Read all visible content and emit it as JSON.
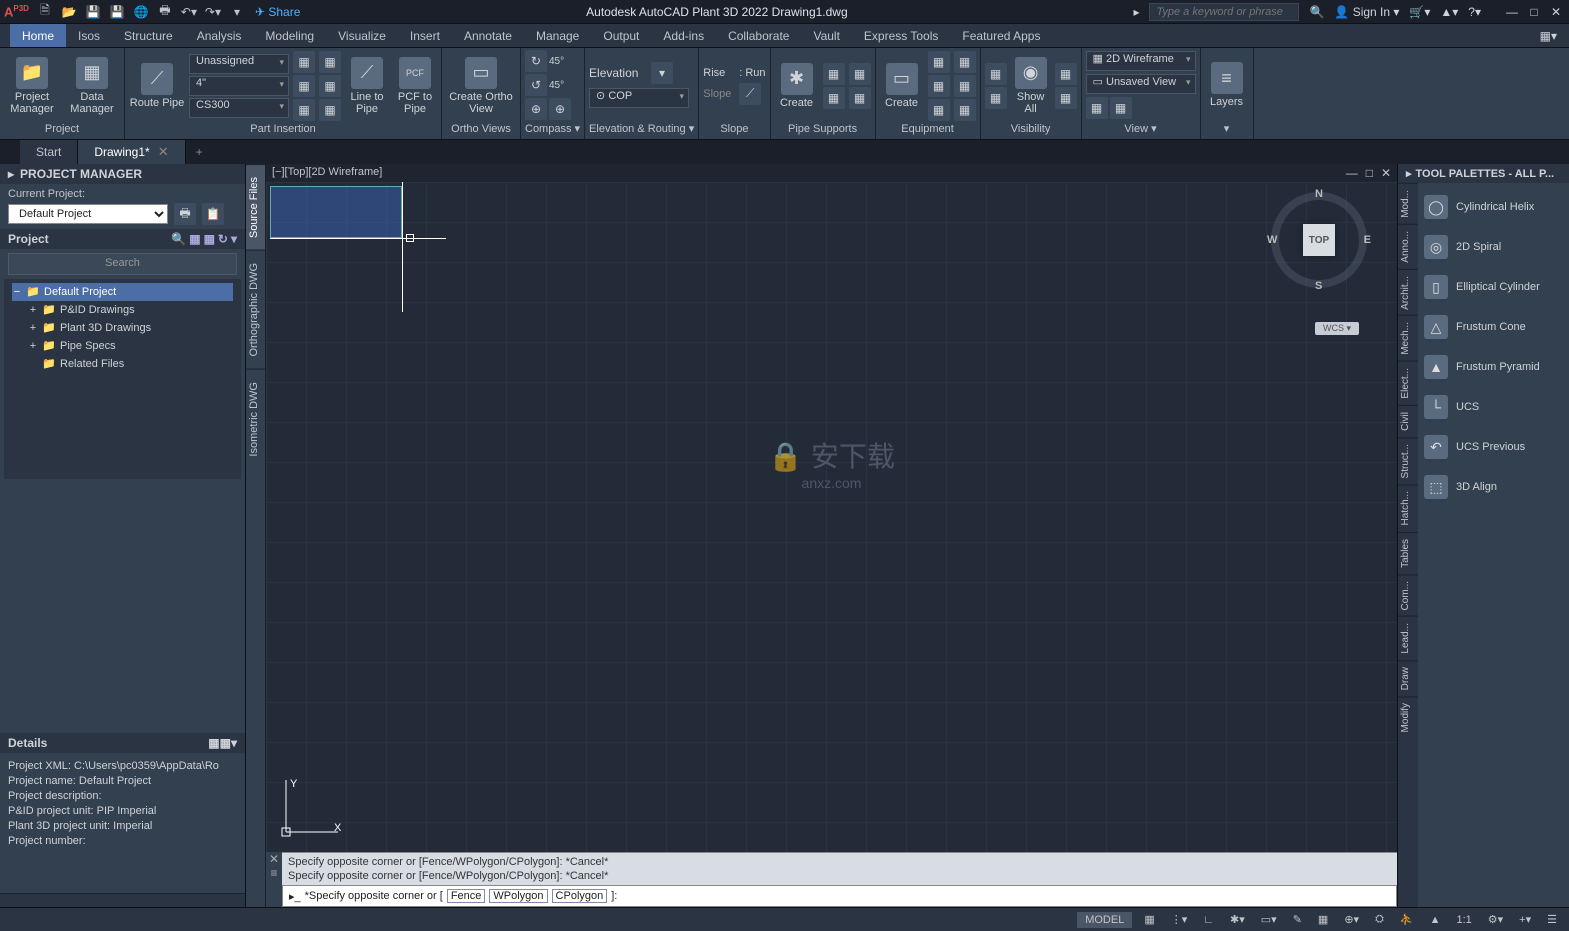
{
  "titlebar": {
    "logo": "A",
    "logo_sup": "P3D",
    "share": "Share",
    "app_title": "Autodesk AutoCAD Plant 3D 2022    Drawing1.dwg",
    "search_placeholder": "Type a keyword or phrase",
    "signin": "Sign In"
  },
  "ribbon_tabs": [
    "Home",
    "Isos",
    "Structure",
    "Analysis",
    "Modeling",
    "Visualize",
    "Insert",
    "Annotate",
    "Manage",
    "Output",
    "Add-ins",
    "Collaborate",
    "Vault",
    "Express Tools",
    "Featured Apps"
  ],
  "ribbon": {
    "project": {
      "title": "Project",
      "btn1": "Project Manager",
      "btn2": "Data Manager"
    },
    "part": {
      "title": "Part Insertion",
      "route": "Route Pipe",
      "unassigned": "Unassigned",
      "size": "4\"",
      "spec": "CS300",
      "line": "Line to Pipe",
      "pcf": "PCF to Pipe",
      "pcf_label": "PCF"
    },
    "ortho": {
      "title": "Ortho Views",
      "create": "Create Ortho View"
    },
    "compass": {
      "title": "Compass",
      "a45a": "45°",
      "a45b": "45°"
    },
    "elev": {
      "title": "Elevation & Routing",
      "elevation": "Elevation",
      "cop": "COP"
    },
    "slope": {
      "title": "Slope",
      "rise": "Rise",
      "run": "Run",
      "slope": "Slope",
      "runval": ": Run"
    },
    "ps": {
      "title": "Pipe Supports",
      "create": "Create"
    },
    "eq": {
      "title": "Equipment",
      "create": "Create"
    },
    "vis": {
      "title": "Visibility",
      "show": "Show All"
    },
    "view": {
      "title": "View",
      "wf": "2D Wireframe",
      "uv": "Unsaved View"
    },
    "layers": {
      "title": "",
      "btn": "Layers"
    }
  },
  "filetabs": {
    "start": "Start",
    "drawing": "Drawing1*"
  },
  "pm": {
    "title": "PROJECT MANAGER",
    "cur": "Current Project:",
    "default": "Default Project",
    "project": "Project",
    "search": "Search",
    "tree": {
      "root": "Default Project",
      "pid": "P&ID Drawings",
      "p3d": "Plant 3D Drawings",
      "pipe": "Pipe Specs",
      "related": "Related Files"
    },
    "details": "Details",
    "d1": "Project XML:  C:\\Users\\pc0359\\AppData\\Ro",
    "d2": "Project name: Default Project",
    "d3": "Project description:",
    "d4": "P&ID project unit: PIP Imperial",
    "d5": "Plant 3D project unit: Imperial",
    "d6": "Project number:"
  },
  "vtabs": [
    "Source Files",
    "Orthographic DWG",
    "Isometric DWG"
  ],
  "canvas": {
    "label": "[−][Top][2D Wireframe]",
    "cube": "TOP",
    "n": "N",
    "s": "S",
    "e": "E",
    "w": "W",
    "wcs": "WCS",
    "y": "Y",
    "x": "X",
    "wm1": "安下载",
    "wm2": "anxz.com",
    "hist1": "Specify opposite corner or [Fence/WPolygon/CPolygon]: *Cancel*",
    "hist2": "Specify opposite corner or [Fence/WPolygon/CPolygon]: *Cancel*",
    "cmd_prompt": "*Specify opposite corner or [",
    "cmd_end": "]:",
    "opt1": "Fence",
    "opt2": "WPolygon",
    "opt3": "CPolygon"
  },
  "tp": {
    "title": "TOOL PALETTES - ALL P...",
    "items": [
      "Cylindrical Helix",
      "2D Spiral",
      "Elliptical Cylinder",
      "Frustum Cone",
      "Frustum Pyramid",
      "UCS",
      "UCS Previous",
      "3D Align"
    ],
    "vtabs": [
      "Mod...",
      "Anno...",
      "Archit...",
      "Mech...",
      "Elect...",
      "Civil",
      "Struct...",
      "Hatch...",
      "Tables",
      "Com...",
      "Lead...",
      "Draw",
      "Modify"
    ]
  },
  "status": {
    "model": "MODEL",
    "ratio": "1:1"
  }
}
